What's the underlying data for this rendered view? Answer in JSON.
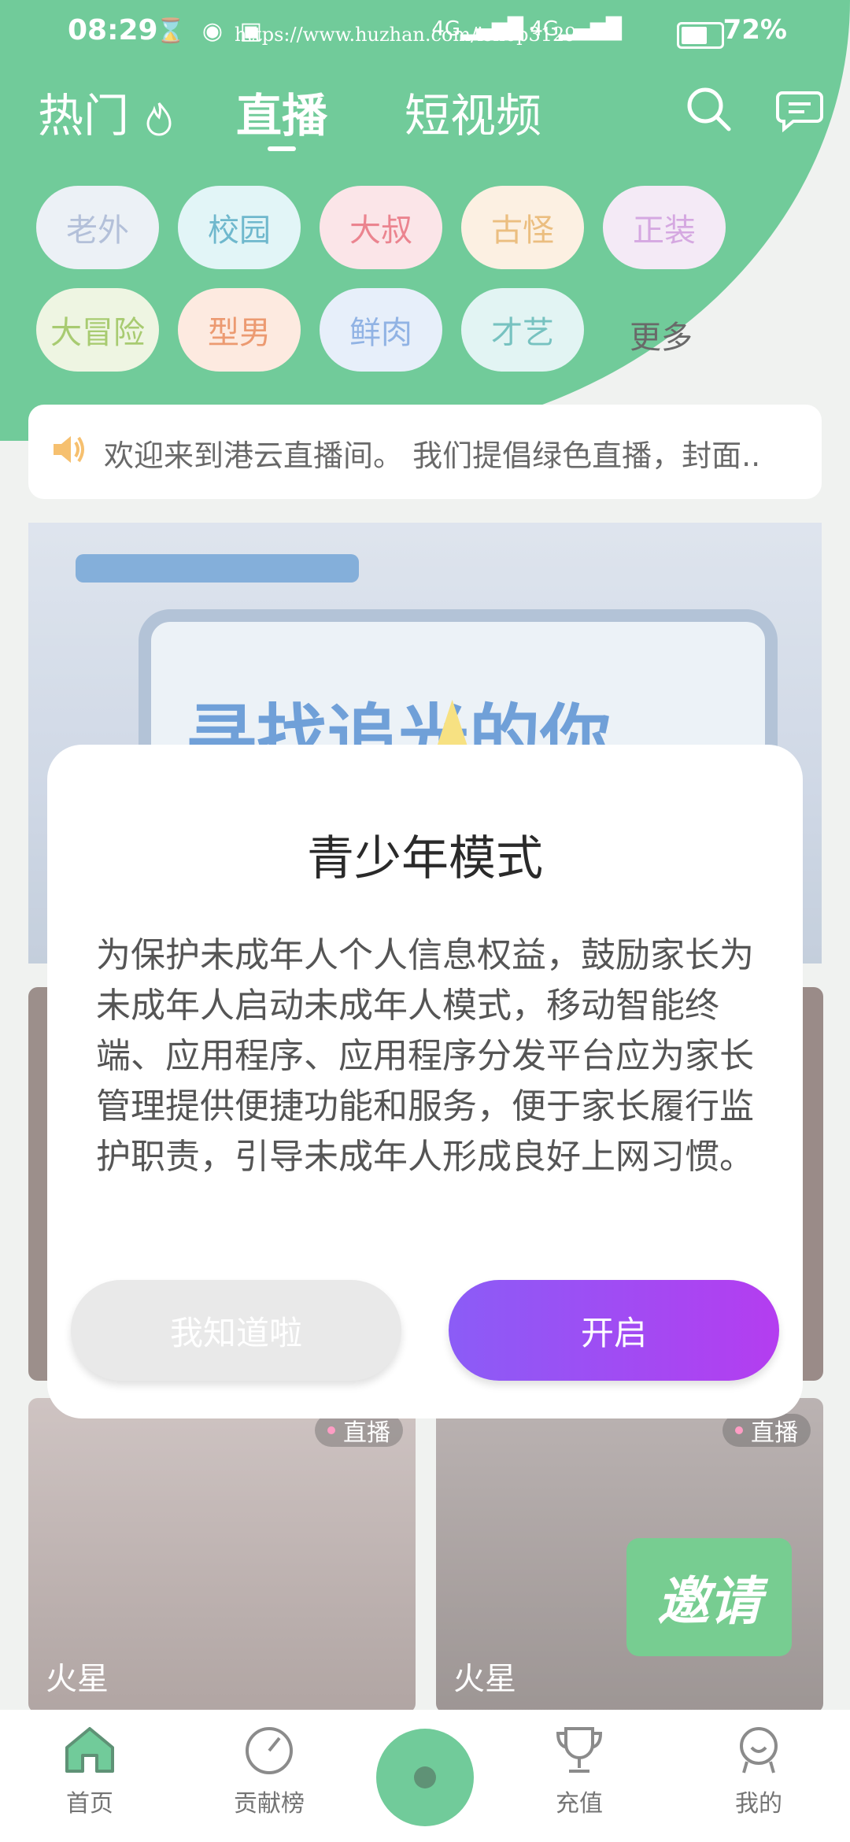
{
  "status": {
    "time": "08:29",
    "url_overlay": "https://www.huzhan.com/ishop3129",
    "signal1": "4G",
    "signal2": "4G",
    "battery": "72%"
  },
  "header": {
    "tabs": [
      {
        "label": "热门"
      },
      {
        "label": "直播"
      },
      {
        "label": "短视频"
      }
    ]
  },
  "categories": {
    "items": [
      {
        "label": "老外",
        "color": "#8fa2c8",
        "bg": "#e3ebf2"
      },
      {
        "label": "校园",
        "color": "#2c97b6",
        "bg": "#d5f0f3"
      },
      {
        "label": "大叔",
        "color": "#e24a5b",
        "bg": "#f9d9de"
      },
      {
        "label": "古怪",
        "color": "#e2a044",
        "bg": "#fbe9d4"
      },
      {
        "label": "正装",
        "color": "#c27fd3",
        "bg": "#efe0f2"
      },
      {
        "label": "大冒险",
        "color": "#7fb32f",
        "bg": "#e6f1d5"
      },
      {
        "label": "型男",
        "color": "#e46a2e",
        "bg": "#fce1d2"
      },
      {
        "label": "鲜肉",
        "color": "#5d8fd8",
        "bg": "#dce8f8"
      },
      {
        "label": "才艺",
        "color": "#37a6a3",
        "bg": "#d4efee"
      }
    ],
    "more_label": "更多"
  },
  "notice": {
    "text": "欢迎来到港云直播间。 我们提倡绿色直播，封面.."
  },
  "banner": {
    "headline": "寻找追光的你"
  },
  "cards": [
    {
      "badge": "直播",
      "name": "火星"
    },
    {
      "badge": "直播",
      "name": "火星"
    }
  ],
  "invite": {
    "label": "邀请"
  },
  "bottom_nav": {
    "items": [
      {
        "label": "首页"
      },
      {
        "label": "贡献榜"
      },
      {
        "label": "充值"
      },
      {
        "label": "我的"
      }
    ]
  },
  "dialog": {
    "title": "青少年模式",
    "body": "为保护未成年人个人信息权益，鼓励家长为未成年人启动未成年人模式，移动智能终端、应用程序、应用程序分发平台应为家长管理提供便捷功能和服务，便于家长履行监护职责，引导未成年人形成良好上网习惯。",
    "dismiss_label": "我知道啦",
    "enable_label": "开启"
  },
  "colors": {
    "brand_green": "#2fb36a",
    "enable_gradient_start": "#8b5cf6",
    "enable_gradient_end": "#b43df0"
  }
}
